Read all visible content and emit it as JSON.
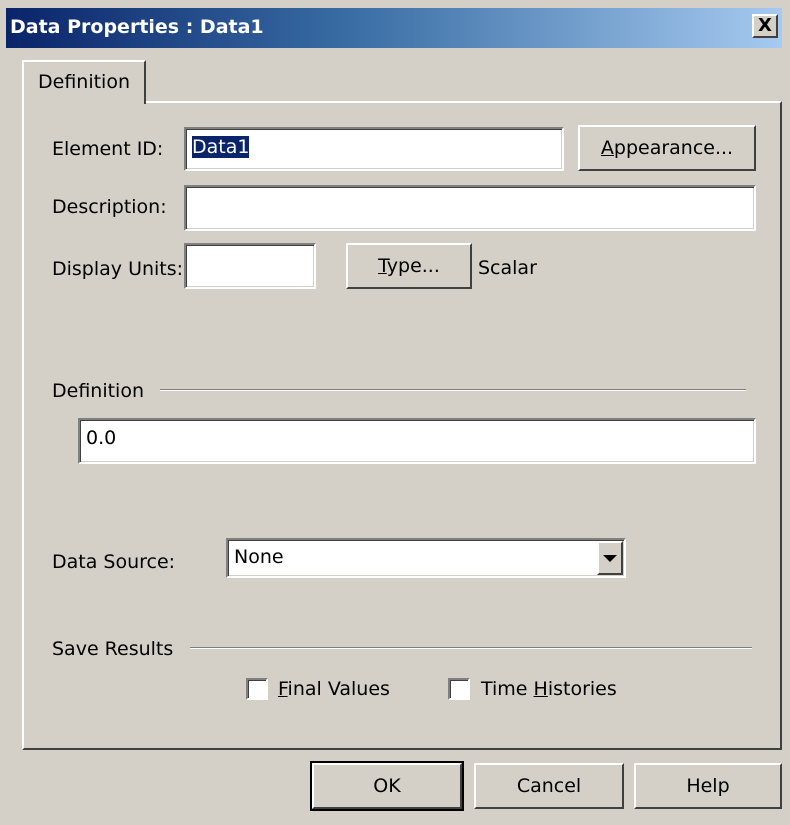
{
  "window": {
    "title": "Data Properties : Data1",
    "close_glyph": "X"
  },
  "tabs": [
    {
      "label": "Definition"
    }
  ],
  "form": {
    "element_id": {
      "label": "Element ID:",
      "value": "Data1"
    },
    "appearance_button": {
      "label_underlined": "A",
      "label_rest": "ppearance..."
    },
    "description": {
      "label": "Description:",
      "value": ""
    },
    "display_units": {
      "label": "Display Units:",
      "value": ""
    },
    "type_button": {
      "label_underlined": "T",
      "label_rest": "ype..."
    },
    "type_value": "Scalar",
    "definition_section": {
      "label": "Definition",
      "value": "0.0"
    },
    "data_source": {
      "label": "Data Source:",
      "selected": "None"
    },
    "save_results": {
      "label": "Save Results",
      "final_values": {
        "label_underlined": "F",
        "label_rest": "inal Values",
        "checked": false
      },
      "time_histories": {
        "label_pre": "Time ",
        "label_underlined": "H",
        "label_rest": "istories",
        "checked": false
      }
    }
  },
  "footer": {
    "ok": "OK",
    "cancel": "Cancel",
    "help": "Help"
  }
}
